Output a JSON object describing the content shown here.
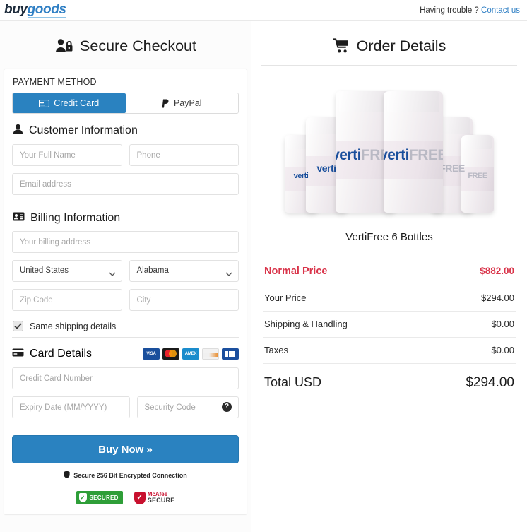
{
  "header": {
    "logo_buy": "buy",
    "logo_goods": "goods",
    "help_text": "Having trouble ?",
    "contact_link": "Contact us"
  },
  "checkout": {
    "heading": "Secure Checkout",
    "payment_method_label": "PAYMENT METHOD",
    "tabs": [
      {
        "label": "Credit Card",
        "icon": "credit-card-icon",
        "active": true
      },
      {
        "label": "PayPal",
        "icon": "paypal-icon",
        "active": false
      }
    ],
    "customer_section": {
      "title": "Customer Information",
      "icon": "user-icon",
      "full_name_placeholder": "Your Full Name",
      "phone_placeholder": "Phone",
      "email_placeholder": "Email address"
    },
    "billing_section": {
      "title": "Billing Information",
      "icon": "address-card-icon",
      "address_placeholder": "Your billing address",
      "country_value": "United States",
      "state_value": "Alabama",
      "zip_placeholder": "Zip Code",
      "city_placeholder": "City"
    },
    "same_shipping": {
      "label": "Same shipping details",
      "checked": true,
      "check_glyph": "✓"
    },
    "card_section": {
      "title": "Card Details",
      "icon": "credit-card-icon",
      "brands": [
        "VISA",
        "Mastercard",
        "AMEX",
        "Discover",
        "JCB"
      ],
      "brand_visa_text": "VISA",
      "brand_amex_text": "AMEX",
      "card_number_placeholder": "Credit Card Number",
      "expiry_placeholder": "Expiry Date (MM/YYYY)",
      "security_placeholder": "Security Code",
      "security_help_glyph": "?"
    },
    "buy_button": "Buy Now »",
    "secure_note": "Secure 256 Bit Encrypted Connection",
    "secure_note_icon": "shield-icon",
    "badges": [
      {
        "name": "norton-secured-badge",
        "text": "SECURED",
        "glyph": "✓"
      },
      {
        "name": "mcafee-secure-badge",
        "line1": "McAfee",
        "line2": "SECURE",
        "glyph": "✓"
      }
    ]
  },
  "order": {
    "heading": "Order Details",
    "heading_icon": "shopping-cart-icon",
    "product_title": "VertiFree 6 Bottles",
    "product_image_alt": "VertiFree supplement bottles",
    "bottle_label_primary": "verti",
    "bottle_label_secondary": "FREE",
    "lines": [
      {
        "label": "Normal Price",
        "value": "$882.00",
        "style": "normal-price"
      },
      {
        "label": "Your Price",
        "value": "$294.00",
        "style": "regular"
      },
      {
        "label": "Shipping & Handling",
        "value": "$0.00",
        "style": "regular"
      },
      {
        "label": "Taxes",
        "value": "$0.00",
        "style": "regular"
      }
    ],
    "total_label": "Total USD",
    "total_value": "$294.00"
  },
  "colors": {
    "accent_blue": "#2a82c0",
    "link_blue": "#2f7fc4",
    "strike_red": "#d9344a",
    "page_bg": "#ffffff"
  }
}
